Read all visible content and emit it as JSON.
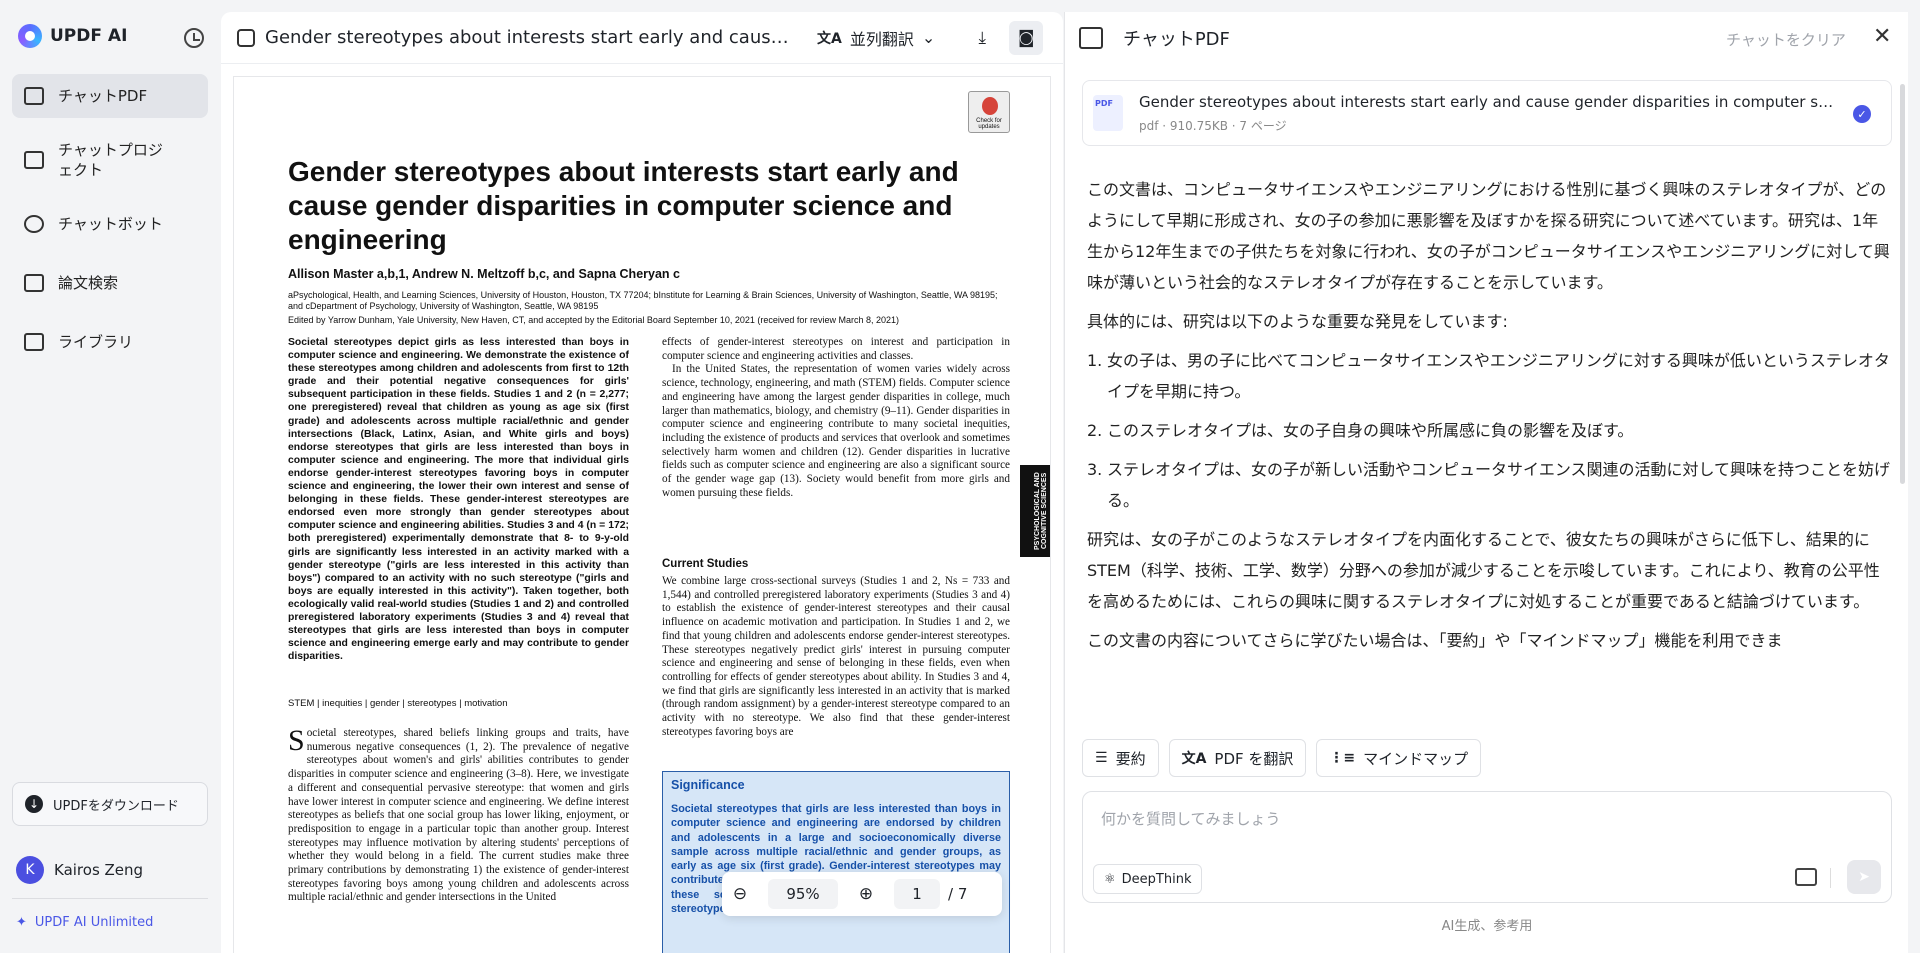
{
  "sidebar": {
    "brand": "UPDF AI",
    "items": [
      {
        "label": "チャットPDF",
        "active": true
      },
      {
        "label": "チャットプロジェクト"
      },
      {
        "label": "チャットボット"
      },
      {
        "label": "論文検索"
      },
      {
        "label": "ライブラリ"
      }
    ],
    "download": "UPDFをダウンロード",
    "user_initial": "K",
    "user_name": "Kairos Zeng",
    "plan": "UPDF AI Unlimited"
  },
  "viewer": {
    "title": "Gender stereotypes about interests start early and cause gen...",
    "translate": "並列翻訳",
    "zoom": "95%",
    "page": "1",
    "total": "/ 7",
    "paper": {
      "check": "Check for updates",
      "title": "Gender stereotypes about interests start early and cause gender disparities in computer science and engineering",
      "authors": "Allison Master a,b,1, Andrew N. Meltzoff b,c, and Sapna Cheryan c",
      "affiliations": "aPsychological, Health, and Learning Sciences, University of Houston, Houston, TX 77204; bInstitute for Learning & Brain Sciences, University of Washington, Seattle, WA 98195; and cDepartment of Psychology, University of Washington, Seattle, WA 98195",
      "edited": "Edited by Yarrow Dunham, Yale University, New Haven, CT, and accepted by the Editorial Board September 10, 2021 (received for review March 8, 2021)",
      "abstract": "Societal stereotypes depict girls as less interested than boys in computer science and engineering. We demonstrate the existence of these stereotypes among children and adolescents from first to 12th grade and their potential negative consequences for girls' subsequent participation in these fields. Studies 1 and 2 (n = 2,277; one preregistered) reveal that children as young as age six (first grade) and adolescents across multiple racial/ethnic and gender intersections (Black, Latinx, Asian, and White girls and boys) endorse stereotypes that girls are less interested than boys in computer science and engineering. The more that individual girls endorse gender-interest stereotypes favoring boys in computer science and engineering, the lower their own interest and sense of belonging in these fields. These gender-interest stereotypes are endorsed even more strongly than gender stereotypes about computer science and engineering abilities. Studies 3 and 4 (n = 172; both preregistered) experimentally demonstrate that 8- to 9-y-old girls are significantly less interested in an activity marked with a gender stereotype (\"girls are less interested in this activity than boys\") compared to an activity with no such stereotype (\"girls and boys are equally interested in this activity\"). Taken together, both ecologically valid real-world studies (Studies 1 and 2) and controlled preregistered laboratory experiments (Studies 3 and 4) reveal that stereotypes that girls are less interested than boys in computer science and engineering emerge early and may contribute to gender disparities.",
      "keywords": "STEM | inequities | gender | stereotypes | motivation",
      "intro_drop": "S",
      "intro": "ocietal stereotypes, shared beliefs linking groups and traits, have numerous negative consequences (1, 2). The prevalence of negative stereotypes about women's and girls' abilities contributes to gender disparities in computer science and engineering (3–8). Here, we investigate a different and consequential pervasive stereotype: that women and girls have lower interest in computer science and engineering. We define interest stereotypes as beliefs that one social group has lower liking, enjoyment, or predisposition to engage in a particular topic than another group. Interest stereotypes may influence motivation by altering students' perceptions of whether they would belong in a field. The current studies make three primary contributions by demonstrating 1) the existence of gender-interest stereotypes favoring boys among young children and adolescents across multiple racial/ethnic and gender intersections in the United",
      "right_p1": "effects of gender-interest stereotypes on interest and participation in computer science and engineering activities and classes.",
      "right_p2": "In the United States, the representation of women varies widely across science, technology, engineering, and math (STEM) fields. Computer science and engineering have among the largest gender disparities in college, much larger than mathematics, biology, and chemistry (9–11). Gender disparities in computer science and engineering contribute to many societal inequities, including the existence of products and services that overlook and sometimes selectively harm women and children (12). Gender disparities in lucrative fields such as computer science and engineering are also a significant source of the gender wage gap (13). Society would benefit from more girls and women pursuing these fields.",
      "current_h": "Current Studies",
      "current": "We combine large cross-sectional surveys (Studies 1 and 2, Ns = 733 and 1,544) and controlled preregistered laboratory experiments (Studies 3 and 4) to establish the existence of gender-interest stereotypes and their causal influence on academic motivation and participation. In Studies 1 and 2, we find that young children and adolescents endorse gender-interest stereotypes. These stereotypes negatively predict girls' interest in pursuing computer science and engineering and sense of belonging in these fields, even when controlling for effects of gender stereotypes about ability. In Studies 3 and 4, we find that girls are significantly less interested in an activity that is marked (through random assignment) by a gender-interest stereotype compared to an activity with no stereotype. We also find that these gender-interest stereotypes favoring boys are",
      "side_tab": "PSYCHOLOGICAL AND COGNITIVE SCIENCES",
      "sig_h": "Significance",
      "sig": "Societal stereotypes that girls are less interested than boys in computer science and engineering are endorsed by children and adolescents in a large and socioeconomically diverse sample across multiple racial/ethnic and gender groups, as early as age six (first grade). Gender-interest stereotypes may contribute to subsequent gender disparities in enrollment in these societally important fields. Addressing interest stereotypes may help improve educational equity."
    }
  },
  "chat": {
    "title": "チャットPDF",
    "clear": "チャットをクリア",
    "file_name": "Gender stereotypes about interests start early and cause gender disparities in computer science and engineering",
    "file_meta": "pdf · 910.75KB · 7 ページ",
    "pdf_label": "PDF",
    "p1": "この文書は、コンピュータサイエンスやエンジニアリングにおける性別に基づく興味のステレオタイプが、どのようにして早期に形成され、女の子の参加に悪影響を及ぼすかを探る研究について述べています。研究は、1年生から12年生までの子供たちを対象に行われ、女の子がコンピュータサイエンスやエンジニアリングに対して興味が薄いという社会的なステレオタイプが存在することを示しています。",
    "p2": "具体的には、研究は以下のような重要な発見をしています:",
    "list": [
      {
        "n": "1.",
        "t": "女の子は、男の子に比べてコンピュータサイエンスやエンジニアリングに対する興味が低いというステレオタイプを早期に持つ。"
      },
      {
        "n": "2.",
        "t": "このステレオタイプは、女の子自身の興味や所属感に負の影響を及ぼす。"
      },
      {
        "n": "3.",
        "t": "ステレオタイプは、女の子が新しい活動やコンピュータサイエンス関連の活動に対して興味を持つことを妨げる。"
      }
    ],
    "p3": "研究は、女の子がこのようなステレオタイプを内面化することで、彼女たちの興味がさらに低下し、結果的にSTEM（科学、技術、工学、数学）分野への参加が減少することを示唆しています。これにより、教育の公平性を高めるためには、これらの興味に関するステレオタイプに対処することが重要であると結論づけています。",
    "p4": "この文書の内容についてさらに学びたい場合は、「要約」や「マインドマップ」機能を利用できま",
    "actions": {
      "summary": "要約",
      "translate": "PDF を翻訳",
      "mindmap": "マインドマップ"
    },
    "placeholder": "何かを質問してみましょう",
    "deepthink": "DeepThink",
    "footer": "AI生成、参考用"
  }
}
